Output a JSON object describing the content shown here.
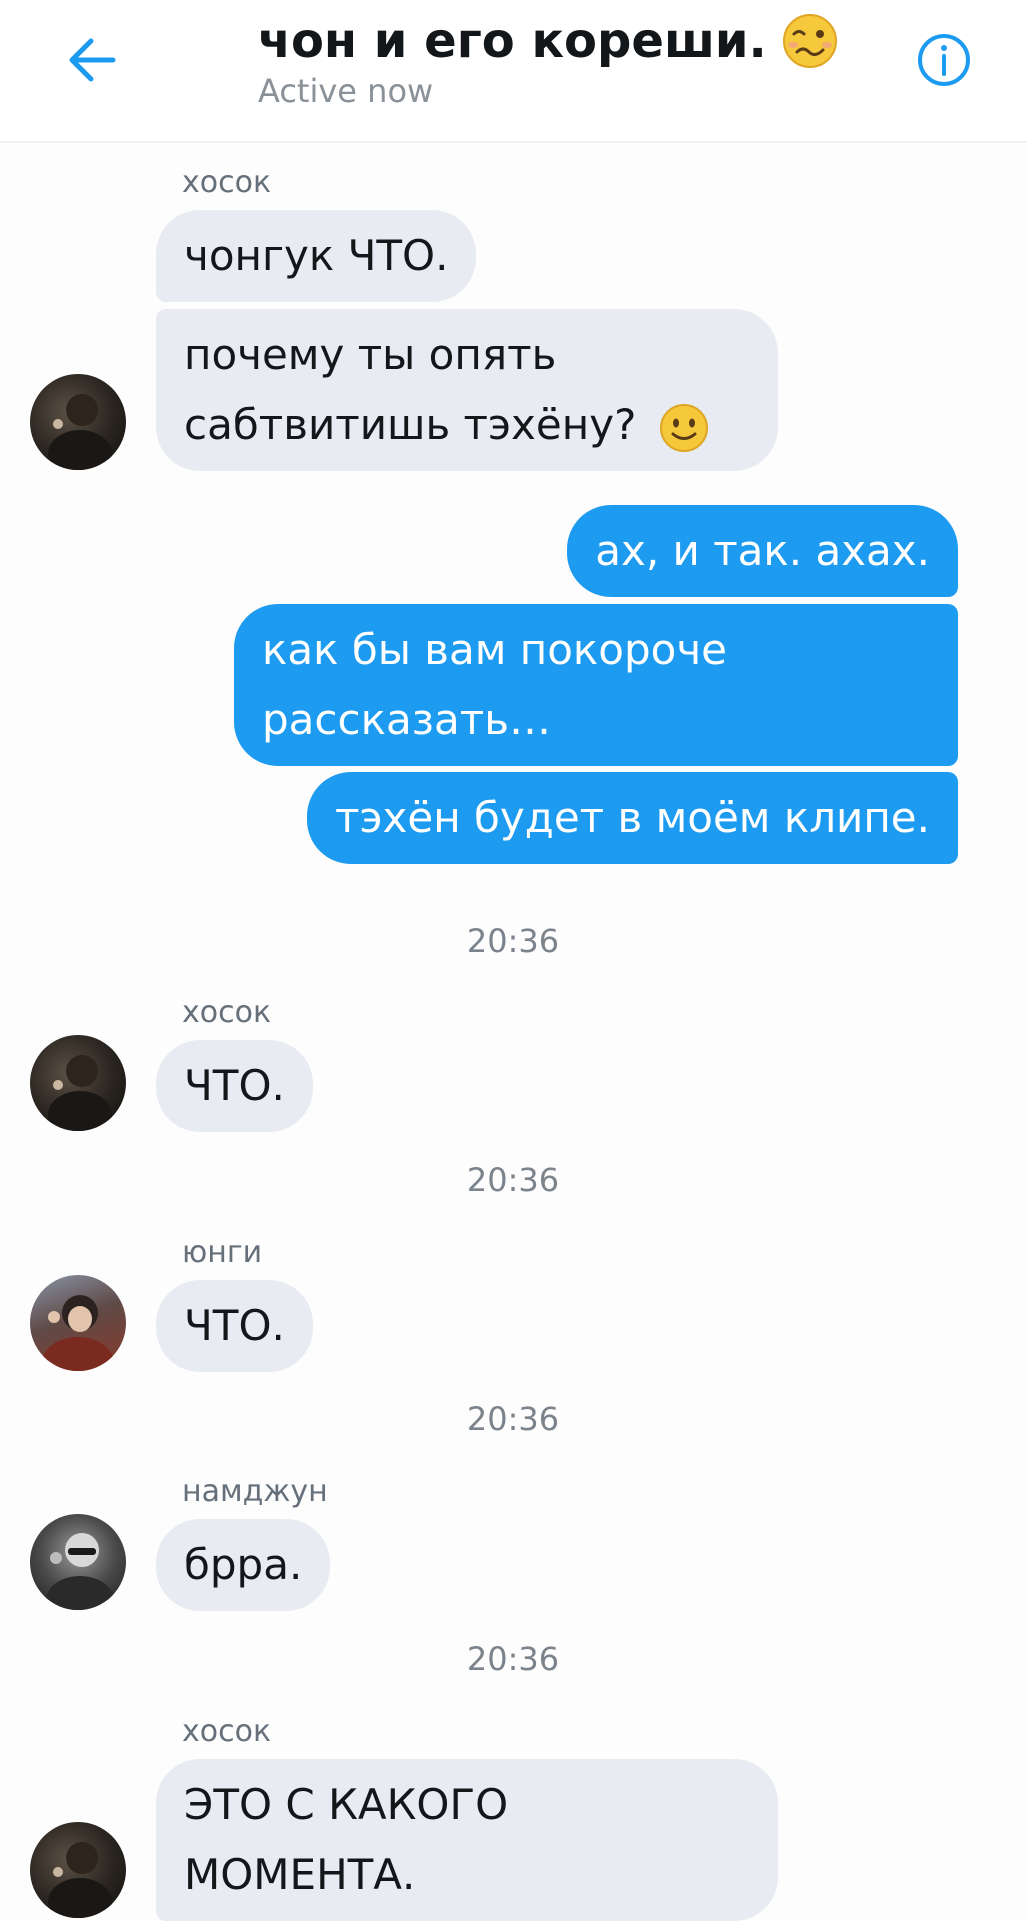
{
  "header": {
    "title": "чон и его кореши.",
    "status": "Active now",
    "title_emoji": "woozy-face-emoji",
    "back_icon": "arrow-left-icon",
    "info_icon": "info-circle-icon",
    "accent_color": "#1d9bf0"
  },
  "messages": {
    "group1": {
      "sender": "хосок",
      "b1": "чонгук ЧТО.",
      "b2_line1": "почему ты опять",
      "b2_line2": "сабтвитишь тэхёну?",
      "b2_emoji": "slightly-smiling-face-emoji"
    },
    "outgoing": {
      "b1": "ах, и так. ахах.",
      "b2_line1": "как бы вам покороче",
      "b2_line2": "рассказать…",
      "b3": "тэхён будет в моём клипе."
    },
    "time1": "20:36",
    "group2": {
      "sender": "хосок",
      "text": "ЧТО."
    },
    "time2": "20:36",
    "group3": {
      "sender": "юнги",
      "text": "ЧТО."
    },
    "time3": "20:36",
    "group4": {
      "sender": "намджун",
      "text": "брра."
    },
    "time4": "20:36",
    "group5": {
      "sender": "хосок",
      "line1": "ЭТО С КАКОГО",
      "line2": "МОМЕНТА."
    }
  },
  "colors": {
    "incoming_bubble": "#e8ebf1",
    "outgoing_bubble": "#1d9bf0",
    "background": "#fdfdfe"
  }
}
